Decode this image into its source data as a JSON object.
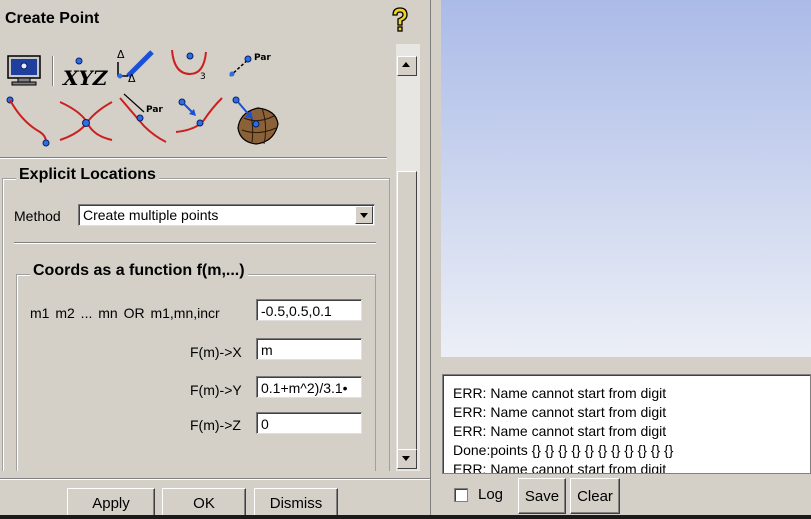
{
  "title": "Create Point",
  "icons": {
    "help": "help-icon",
    "row1": [
      "screen-location-icon",
      "xyz-coordinates-icon",
      "parameter-offset-icon",
      "arc-center-icon",
      "parameter-along-line-icon"
    ],
    "row2": [
      "curve-endpoint-icon",
      "curve-intersection-icon",
      "parameter-on-curve-icon",
      "project-to-curve-icon",
      "project-to-surface-icon"
    ],
    "param_label": "Par",
    "xyz_label": "XYZ",
    "subscript_3": "3"
  },
  "section": {
    "title": "Explicit Locations",
    "method_label": "Method",
    "method_value": "Create multiple points",
    "group_title": "Coords as a function f(m,...)",
    "params_label": "m1 m2 ... mn   OR   m1,mn,incr",
    "params_value": "-0.5,0.5,0.1",
    "fx_label": "F(m)->X",
    "fx_value": "m",
    "fy_label": "F(m)->Y",
    "fy_value": "0.1+m^2)/3.1•",
    "fz_label": "F(m)->Z",
    "fz_value": "0"
  },
  "buttons": {
    "apply": "Apply",
    "ok": "OK",
    "dismiss": "Dismiss"
  },
  "log": {
    "lines": [
      "ERR: Name cannot start from digit",
      "ERR: Name cannot start from digit",
      "ERR: Name cannot start from digit",
      "Done:points {} {} {} {} {} {} {} {} {} {} {}",
      "ERR: Name cannot start from digit"
    ],
    "log_label": "Log",
    "save_label": "Save",
    "clear_label": "Clear"
  },
  "colors": {
    "panel": "#d4d0c8",
    "viewport_top": "#abbbe8",
    "viewport_bottom": "#eceff6",
    "curve_red": "#cc2020",
    "point_blue": "#1a5fd8"
  }
}
